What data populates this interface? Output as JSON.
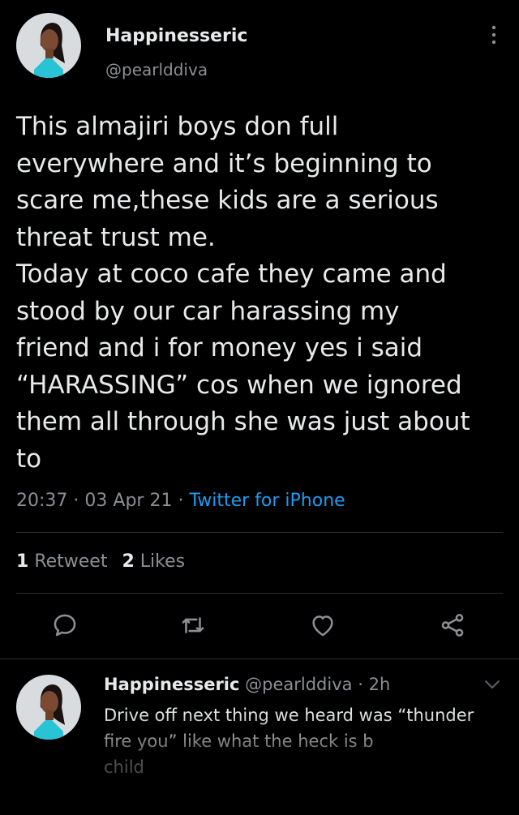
{
  "tweet": {
    "display_name": "Happinesseric",
    "handle": "@pearlddiva",
    "text": "This almajiri boys don full\neverywhere and it’s beginning to\nscare me,these kids are a serious\nthreat trust me.\nToday at coco cafe they came and\nstood by our car harassing my\nfriend and i for money yes i said\n“HARASSING” cos when we ignored\nthem all through she was just about\nto",
    "time": "20:37",
    "date": "03 Apr 21",
    "source": "Twitter for iPhone",
    "retweets_count": "1",
    "retweets_label": "Retweet",
    "likes_count": "2",
    "likes_label": "Likes"
  },
  "reply": {
    "display_name": "Happinesseric",
    "handle": "@pearlddiva",
    "age": "2h",
    "text": "Drive off next thing we heard was “thunder\nfire you” like what the heck is b\nchild"
  },
  "colors": {
    "background": "#000000",
    "text": "#e7e9ea",
    "secondary": "#8b8f94",
    "link": "#1d9bf0",
    "divider": "#2b2e31"
  },
  "icons": [
    "more-icon",
    "reply-icon",
    "retweet-icon",
    "like-icon",
    "share-icon",
    "chevron-down-icon"
  ]
}
